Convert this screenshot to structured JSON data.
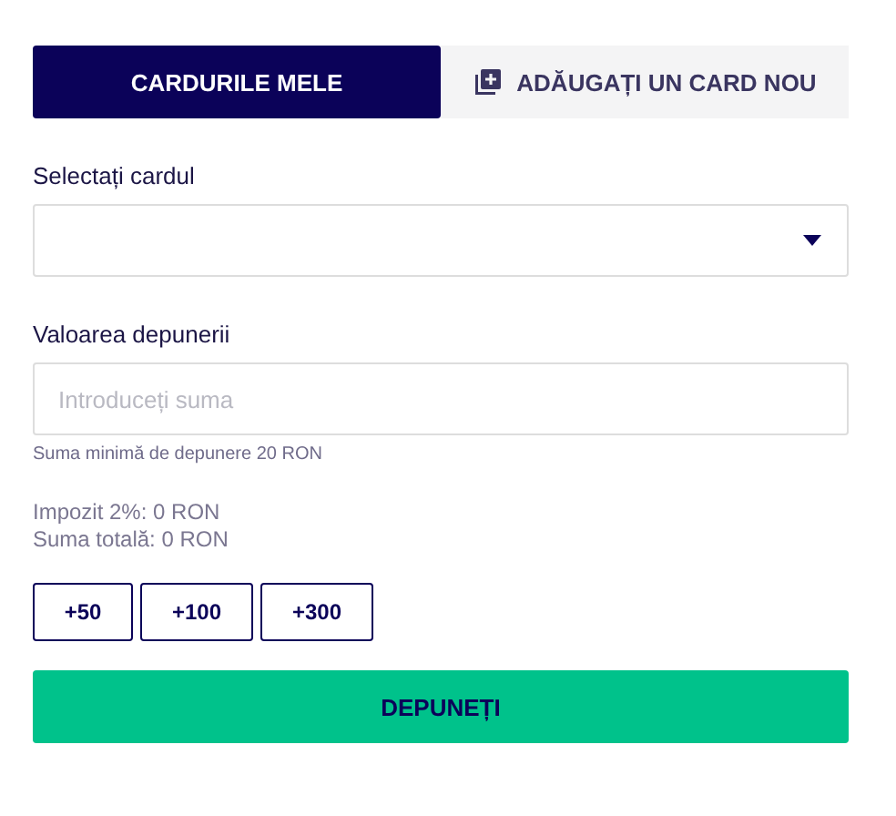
{
  "tabs": [
    {
      "label": "CARDURILE MELE",
      "selected": true,
      "kind": "plain"
    },
    {
      "label": "ADĂUGAȚI UN CARD NOU",
      "selected": false,
      "kind": "add"
    }
  ],
  "card_select": {
    "label": "Selectați cardul"
  },
  "amount": {
    "label": "Valoarea depunerii",
    "placeholder": "Introduceți suma",
    "hint": "Suma minimă de depunere 20 RON"
  },
  "summary": [
    "Impozit 2%: 0 RON",
    "Suma totală: 0 RON"
  ],
  "quick_amounts": [
    "+50",
    "+100",
    "+300"
  ],
  "submit": "DEPUNEȚI"
}
